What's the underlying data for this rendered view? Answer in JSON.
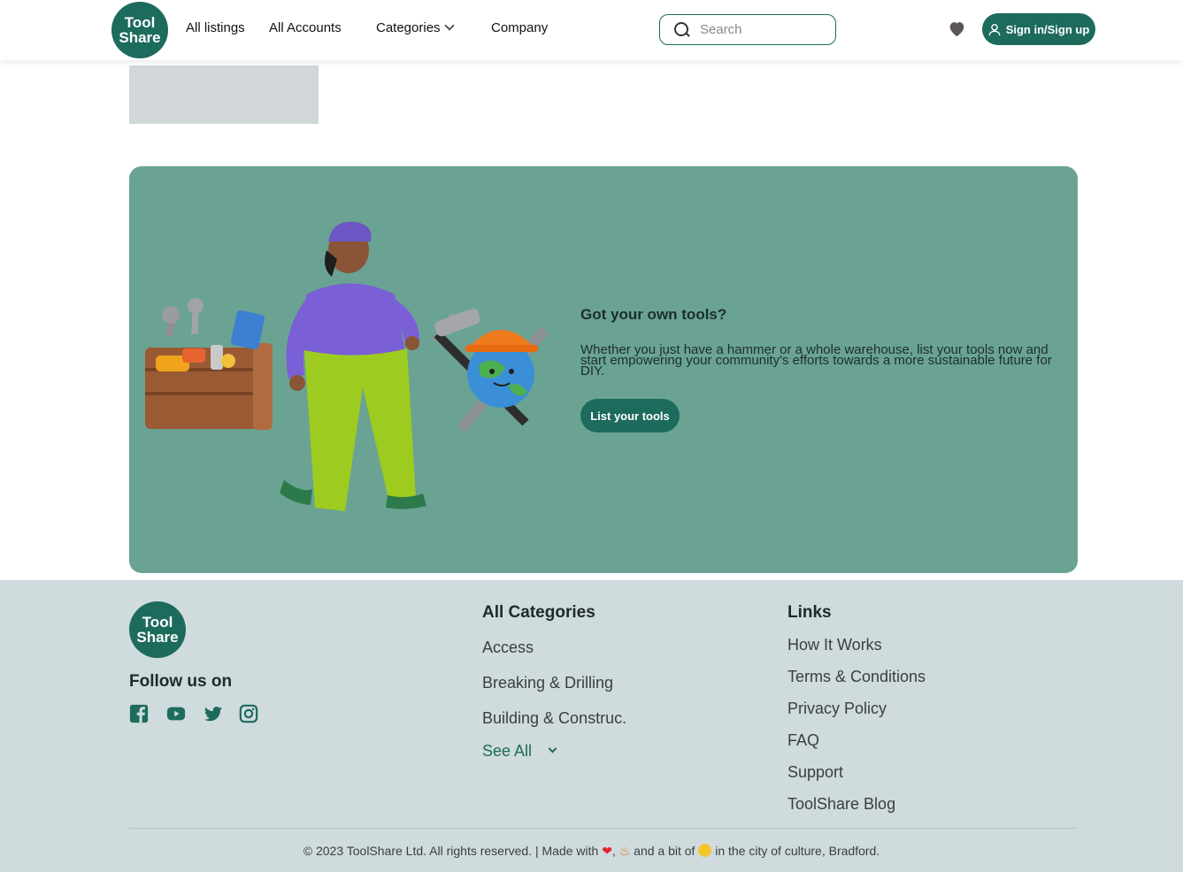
{
  "header": {
    "logo_line1": "Tool",
    "logo_line2": "Share",
    "nav": {
      "all_listings": "All listings",
      "all_accounts": "All Accounts",
      "categories": "Categories",
      "company": "Company"
    },
    "search_placeholder": "Search",
    "signin_label": "Sign in/Sign up"
  },
  "banner": {
    "title": "Got your own tools?",
    "text": "Whether you just have a hammer or a whole warehouse, list your tools now and start empowering your community's efforts towards a more sustainable future for DIY.",
    "button_label": "List your tools"
  },
  "footer": {
    "logo_line1": "Tool",
    "logo_line2": "Share",
    "follow_label": "Follow us on",
    "socials": [
      "facebook-icon",
      "youtube-icon",
      "twitter-icon",
      "instagram-icon"
    ],
    "categories": {
      "title": "All Categories",
      "items": [
        "Access",
        "Breaking & Drilling",
        "Building & Construc."
      ],
      "see_all": "See All"
    },
    "links": {
      "title": "Links",
      "items": [
        "How It Works",
        "Terms & Conditions",
        "Privacy Policy",
        "FAQ",
        "Support",
        "ToolShare Blog"
      ]
    },
    "copyright_prefix": "© 2023 ToolShare Ltd. All rights reserved. | Made with",
    "copyright_mid": ", ",
    "copyright_and": " and a bit of ",
    "copyright_suffix": "in the city of culture, Bradford."
  },
  "colors": {
    "brand": "#1d6b5c",
    "banner_bg": "#6aa393",
    "footer_bg": "#cfdbdc"
  }
}
